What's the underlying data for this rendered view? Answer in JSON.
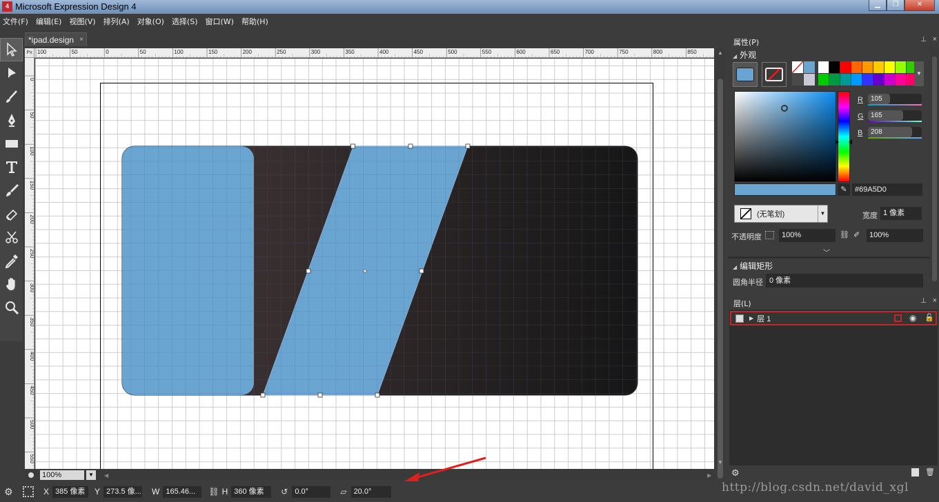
{
  "window": {
    "title": "Microsoft Expression Design 4",
    "app_icon_text": "4"
  },
  "menu": [
    "文件(F)",
    "编辑(E)",
    "视图(V)",
    "排列(A)",
    "对象(O)",
    "选择(S)",
    "窗口(W)",
    "帮助(H)"
  ],
  "tools": [
    "selection-tool",
    "direct-selection-tool",
    "brush-tool",
    "pen-tool",
    "rectangle-tool",
    "text-tool",
    "paint-brush-tool",
    "eraser-tool",
    "scissors-tool",
    "eyedropper-tool",
    "pan-tool",
    "zoom-tool"
  ],
  "document_tab": {
    "label": "*ipad.design",
    "close": "×"
  },
  "ruler": {
    "unit": "Px",
    "top_ticks": [
      "100",
      "50",
      "0",
      "50",
      "100",
      "150",
      "200",
      "250",
      "300",
      "350",
      "400",
      "450",
      "500",
      "550",
      "600",
      "650",
      "700",
      "750",
      "800",
      "850"
    ],
    "left_ticks": [
      "0",
      "50",
      "100",
      "150",
      "200",
      "250",
      "300",
      "350",
      "400",
      "450",
      "500",
      "550"
    ]
  },
  "zoom": {
    "value": "100%"
  },
  "status": {
    "x_label": "X",
    "x_value": "385 像素",
    "y_label": "Y",
    "y_value": "273.5 像...",
    "w_label": "W",
    "w_value": "165.46...",
    "h_label": "H",
    "h_value": "360 像素",
    "rotate_value": "0.0°",
    "skew_value": "20.0°"
  },
  "properties": {
    "title": "属性(P)",
    "appearance": "外观",
    "rgb": {
      "r_label": "R",
      "r": "105",
      "g_label": "G",
      "g": "165",
      "b_label": "B",
      "b": "208"
    },
    "r_fraction": 0.41,
    "g_fraction": 0.65,
    "b_fraction": 0.82,
    "hex": "#69A5D0",
    "fill_color": "#69A5D0",
    "stroke": {
      "value": "(无笔划)",
      "width_label": "宽度",
      "width_value": "1 像素"
    },
    "opacity_label": "不透明度",
    "opacity_value": "100%",
    "opacity_value2": "100%",
    "palette": [
      "#ffffff",
      "#000000",
      "#ff0000",
      "#ff6600",
      "#ff9900",
      "#ffcc00",
      "#ffff00",
      "#99ff00",
      "#33cc00",
      "#00cc00",
      "#009944",
      "#009999",
      "#0099ff",
      "#3333ff",
      "#6600cc",
      "#cc00cc",
      "#ff0099",
      "#ff0066"
    ]
  },
  "edit_rect": {
    "title": "编辑矩形",
    "corner_label": "圆角半径",
    "corner_value": "0 像素"
  },
  "layers": {
    "title": "层(L)",
    "items": [
      {
        "name": "层 1"
      }
    ]
  },
  "watermark": "http://blog.csdn.net/david_xgl"
}
